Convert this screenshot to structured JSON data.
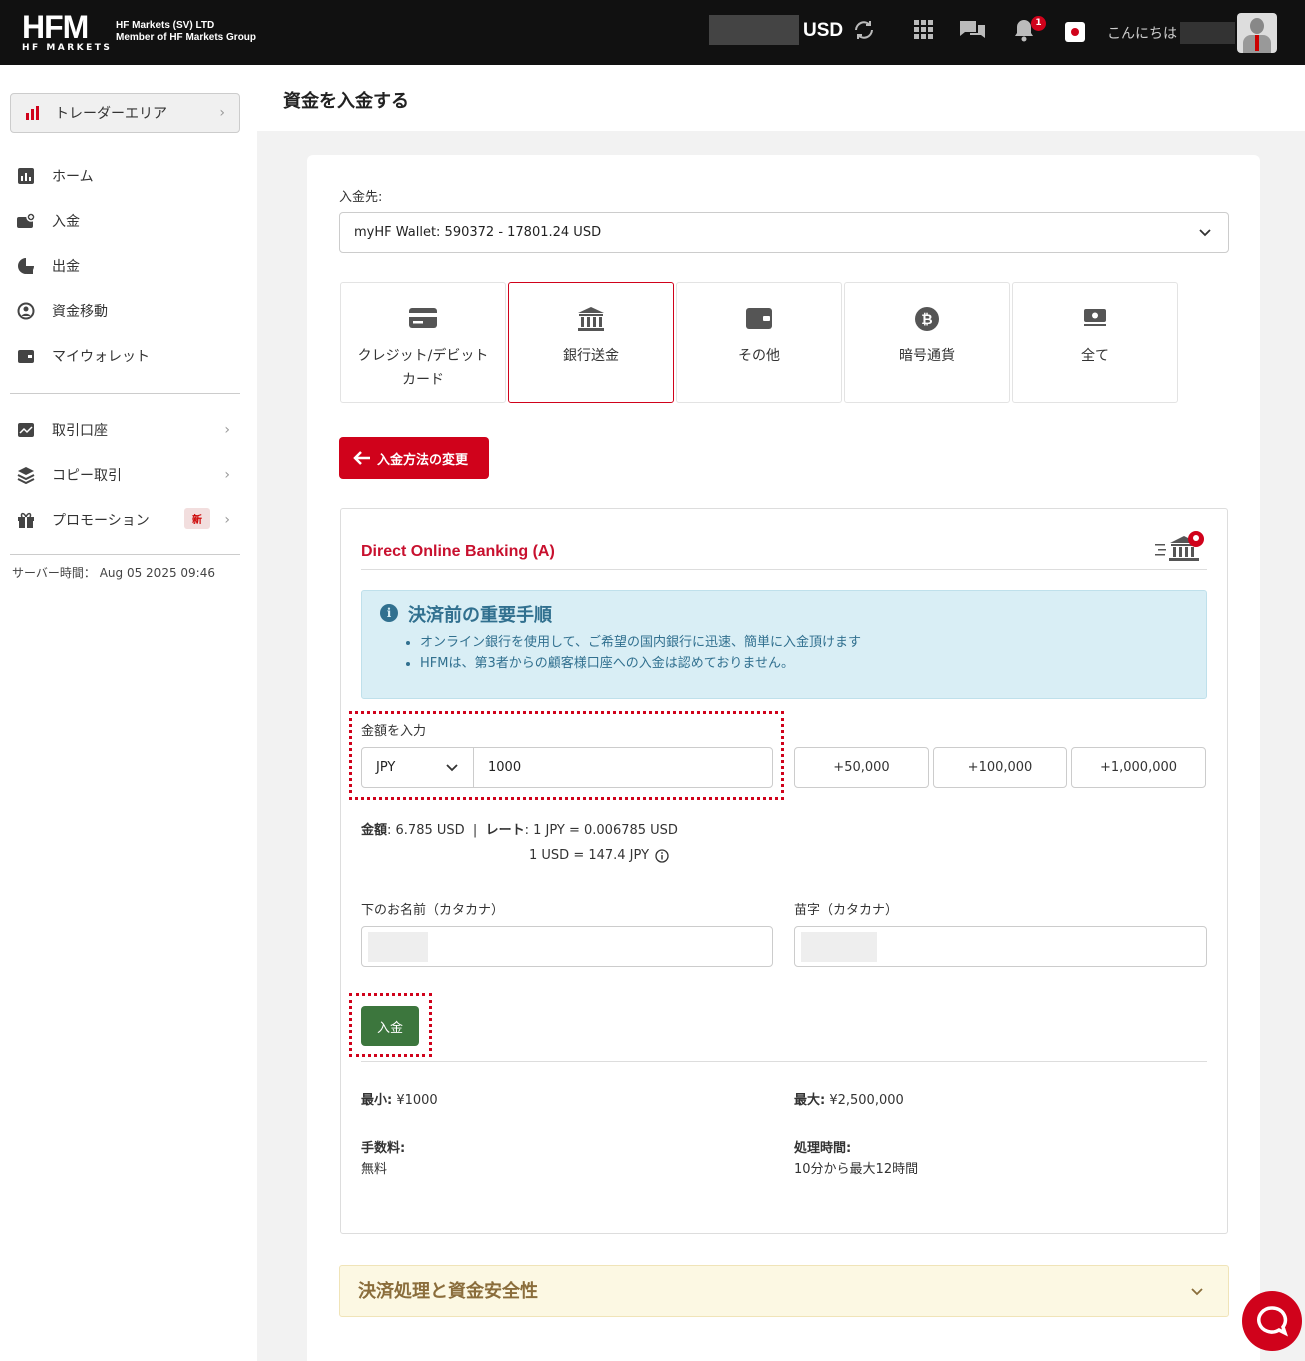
{
  "header": {
    "logo_text": "HFM",
    "logo_sub": "HF MARKETS",
    "company_line1": "HF Markets (SV) LTD",
    "company_line2": "Member of HF Markets Group",
    "currency": "USD",
    "notification_count": "1",
    "greeting": "こんにちは"
  },
  "sidebar": {
    "trader_area": "トレーダーエリア",
    "items": [
      {
        "label": "ホーム",
        "icon": "chart-icon"
      },
      {
        "label": "入金",
        "icon": "deposit-icon"
      },
      {
        "label": "出金",
        "icon": "withdraw-icon"
      },
      {
        "label": "資金移動",
        "icon": "transfer-icon"
      },
      {
        "label": "マイウォレット",
        "icon": "wallet-icon"
      }
    ],
    "items2": [
      {
        "label": "取引口座",
        "icon": "trading-account-icon"
      },
      {
        "label": "コピー取引",
        "icon": "copy-trading-icon"
      },
      {
        "label": "プロモーション",
        "icon": "gift-icon",
        "badge": "新"
      }
    ],
    "server_time_label": "サーバー時間：",
    "server_time": "Aug 05 2025 09:46"
  },
  "main": {
    "page_title": "資金を入金する",
    "deposit_to_label": "入金先:",
    "deposit_to_value": "myHF Wallet: 590372 - 17801.24 USD",
    "methods": [
      {
        "label": "クレジット/デビットカード",
        "icon": "credit-card-icon"
      },
      {
        "label": "銀行送金",
        "icon": "bank-icon",
        "active": true
      },
      {
        "label": "その他",
        "icon": "wallet-icon"
      },
      {
        "label": "暗号通貨",
        "icon": "bitcoin-icon"
      },
      {
        "label": "全て",
        "icon": "cash-icon"
      }
    ],
    "change_method": "入金方法の変更",
    "bank": {
      "title": "Direct Online Banking (A)",
      "info_title": "決済前の重要手順",
      "info_items": [
        "オンライン銀行を使用して、ご希望の国内銀行に迅速、簡単に入金頂けます",
        "HFMは、第3者からの顧客様口座への入金は認めておりません。"
      ],
      "amount_label": "金額を入力",
      "currency": "JPY",
      "amount": "1000",
      "quick_amounts": [
        "+50,000",
        "+100,000",
        "+1,000,000"
      ],
      "amount_result_label": "金額",
      "amount_result": ": 6.785 USD  |  ",
      "rate_label": "レート",
      "rate_value": ": 1 JPY = 0.006785 USD",
      "rate_inverse": "1 USD = 147.4 JPY",
      "first_name_label": "下のお名前（カタカナ）",
      "last_name_label": "苗字（カタカナ）",
      "submit": "入金",
      "min_label": "最小:",
      "min_value": " ¥1000",
      "max_label": "最大:",
      "max_value": " ¥2,500,000",
      "fee_label": "手数料:",
      "fee_value": "無料",
      "time_label": "処理時間:",
      "time_value": "10分から最大12時間"
    },
    "accordion_title": "決済処理と資金安全性"
  },
  "colors": {
    "brand_red": "#d0021b",
    "success_green": "#3c763d",
    "info_blue": "#31708f"
  }
}
